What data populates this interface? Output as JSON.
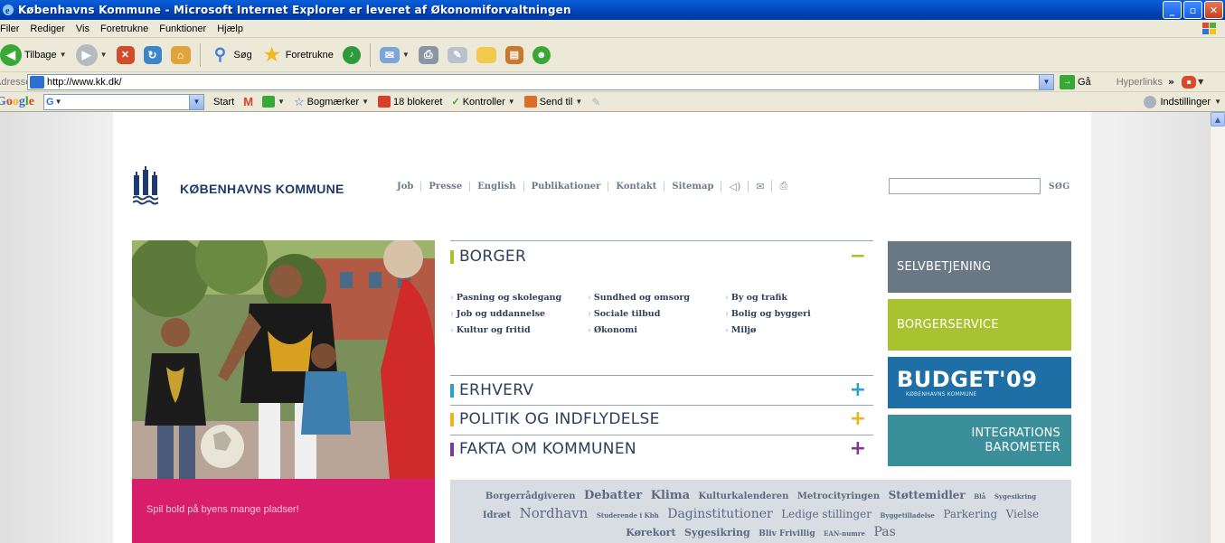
{
  "window": {
    "title": "Københavns Kommune - Microsoft Internet Explorer er leveret af Økonomiforvaltningen",
    "buttons": [
      "_",
      "▫",
      "✕"
    ]
  },
  "menu": [
    "Filer",
    "Rediger",
    "Vis",
    "Foretrukne",
    "Funktioner",
    "Hjælp"
  ],
  "toolbar": {
    "back_label": "Tilbage",
    "search_label": "Søg",
    "favorites_label": "Foretrukne",
    "colors": {
      "back": "#3aa836",
      "forward": "#9aa0a8",
      "stop": "#d24b2a",
      "refresh": "#3c86c8",
      "home": "#e0a43a",
      "search": "#3c7fd8",
      "favorites": "#f2b81e",
      "media": "#2f9a3c"
    }
  },
  "addressbar": {
    "label": "Adresse",
    "url": "http://www.kk.dk/",
    "go_label": "Gå",
    "links_label": "Hyperlinks",
    "chevron": "»"
  },
  "googlebar": {
    "logo": "Google",
    "search_value": "G",
    "start_label": "Start",
    "bookmarks_label": "Bogmærker",
    "blocked_label": "18 blokeret",
    "check_label": "Kontroller",
    "send_label": "Send til",
    "settings_label": "Indstillinger"
  },
  "site": {
    "brand": "KØBENHAVNS KOMMUNE",
    "topnav": [
      "Job",
      "Presse",
      "English",
      "Publikationer",
      "Kontakt",
      "Sitemap"
    ],
    "topnav_icons": [
      "speaker-icon",
      "mail-icon",
      "print-icon"
    ],
    "search_label": "SØG",
    "hero_caption": "Spil bold på byens mange pladser!",
    "sections": [
      {
        "label": "BORGER",
        "toggle": "−",
        "color": "#a6c32a"
      },
      {
        "label": "ERHVERV",
        "toggle": "+",
        "color": "#2aa3c6"
      },
      {
        "label": "POLITIK OG INDFLYDELSE",
        "toggle": "+",
        "color": "#f0b21e"
      },
      {
        "label": "FAKTA OM KOMMUNEN",
        "toggle": "+",
        "color": "#7a3a9a"
      }
    ],
    "borger_links": [
      [
        "Pasning og skolegang",
        "Sundhed og omsorg",
        "By og trafik"
      ],
      [
        "Job og uddannelse",
        "Sociale tilbud",
        "Bolig og byggeri"
      ],
      [
        "Kultur og fritid",
        "Økonomi",
        "Miljø"
      ]
    ],
    "side_buttons": {
      "selfservice": "SELVBETJENING",
      "citizenservice": "BORGERSERVICE",
      "budget": "BUDGET'09",
      "budget_sub": "KØBENHAVNS KOMMUNE",
      "integration_line1": "INTEGRATIONS",
      "integration_line2": "BAROMETER"
    },
    "tags": [
      {
        "t": "Borgerrådgiveren",
        "s": 10
      },
      {
        "t": "Debatter",
        "s": 13
      },
      {
        "t": "Klima",
        "s": 13
      },
      {
        "t": "Kulturkalenderen",
        "s": 10
      },
      {
        "t": "Metrocityringen",
        "s": 10
      },
      {
        "t": "Støttemidler",
        "s": 12
      },
      {
        "t": "Blå",
        "s": 7
      },
      {
        "t": "Sygesikring",
        "s": 7
      },
      {
        "t": "Idræt",
        "s": 10
      },
      {
        "t": "Nordhavn",
        "s": 15
      },
      {
        "t": "Studerende i Kbh",
        "s": 7
      },
      {
        "t": "Daginstitutioner",
        "s": 14
      },
      {
        "t": "Ledige stillinger",
        "s": 12
      },
      {
        "t": "Byggetilladelse",
        "s": 7
      },
      {
        "t": "Parkering",
        "s": 12
      },
      {
        "t": "Vielse",
        "s": 12
      },
      {
        "t": "Kørekort",
        "s": 11
      },
      {
        "t": "Sygesikring",
        "s": 11
      },
      {
        "t": "Bliv Frivillig",
        "s": 9
      },
      {
        "t": "EAN-numre",
        "s": 7
      },
      {
        "t": "Pas",
        "s": 14
      }
    ]
  }
}
